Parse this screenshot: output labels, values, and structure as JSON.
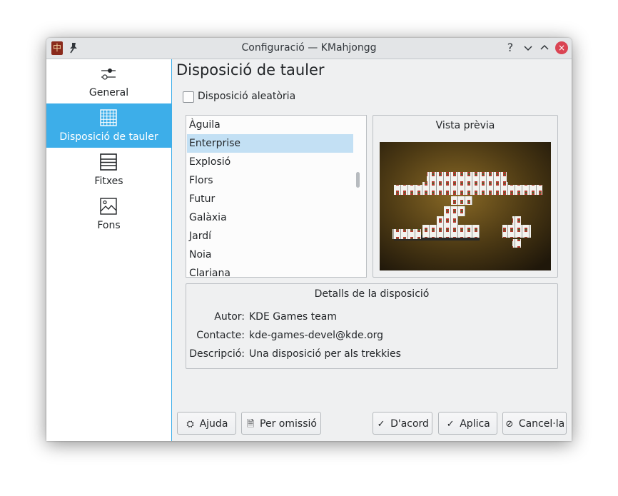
{
  "window": {
    "title": "Configuració — KMahjongg",
    "app_icon": "kmahjongg-icon",
    "title_buttons": {
      "help": "?",
      "minimize": "⌄",
      "maximize": "⌃",
      "close": "×"
    }
  },
  "sidebar": {
    "items": [
      {
        "label": "General",
        "icon": "sliders-icon",
        "active": false
      },
      {
        "label": "Disposició de tauler",
        "icon": "grid-icon",
        "active": true
      },
      {
        "label": "Fitxes",
        "icon": "list-lines-icon",
        "active": false
      },
      {
        "label": "Fons",
        "icon": "image-icon",
        "active": false
      }
    ]
  },
  "main": {
    "page_title": "Disposició de tauler",
    "random_layout": {
      "label": "Disposició aleatòria",
      "checked": false
    },
    "layouts": [
      "Àguila",
      "Enterprise",
      "Explosió",
      "Flors",
      "Futur",
      "Galàxia",
      "Jardí",
      "Noia",
      "Clariana"
    ],
    "selected_layout": "Enterprise",
    "preview": {
      "title": "Vista prèvia"
    },
    "details": {
      "title": "Detalls de la disposició",
      "author_label": "Autor:",
      "author": "KDE Games team",
      "contact_label": "Contacte:",
      "contact": "kde-games-devel@kde.org",
      "description_label": "Descripció:",
      "description": "Una disposició per als trekkies"
    }
  },
  "buttons": {
    "help": "Ajuda",
    "defaults": "Per omissió",
    "ok": "D'acord",
    "apply": "Aplica",
    "cancel": "Cancel·la"
  },
  "colors": {
    "accent": "#3daee9",
    "selection": "#c3e0f4",
    "close": "#da4453"
  }
}
